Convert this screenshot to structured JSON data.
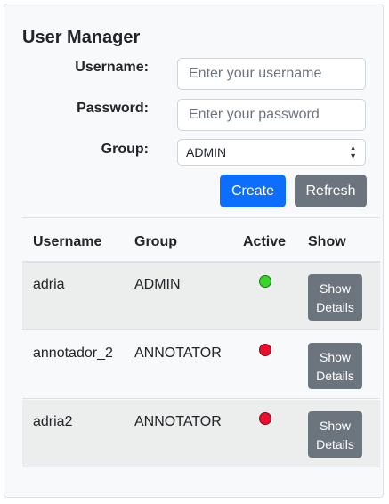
{
  "title": "User Manager",
  "form": {
    "username_label": "Username:",
    "username_placeholder": "Enter your username",
    "password_label": "Password:",
    "password_placeholder": "Enter your password",
    "group_label": "Group:",
    "group_value": "ADMIN",
    "create_label": "Create",
    "refresh_label": "Refresh"
  },
  "table": {
    "headers": [
      "Username",
      "Group",
      "Active",
      "Show"
    ],
    "rows": [
      {
        "username": "adria",
        "group": "ADMIN",
        "active": true,
        "show_label": "Show Details"
      },
      {
        "username": "annotador_2",
        "group": "ANNOTATOR",
        "active": false,
        "show_label": "Show Details"
      },
      {
        "username": "adria2",
        "group": "ANNOTATOR",
        "active": false,
        "show_label": "Show Details"
      }
    ]
  },
  "colors": {
    "active": "#3ad52b",
    "inactive": "#e8112d",
    "primary": "#0d6efd",
    "secondary": "#6c757d"
  }
}
